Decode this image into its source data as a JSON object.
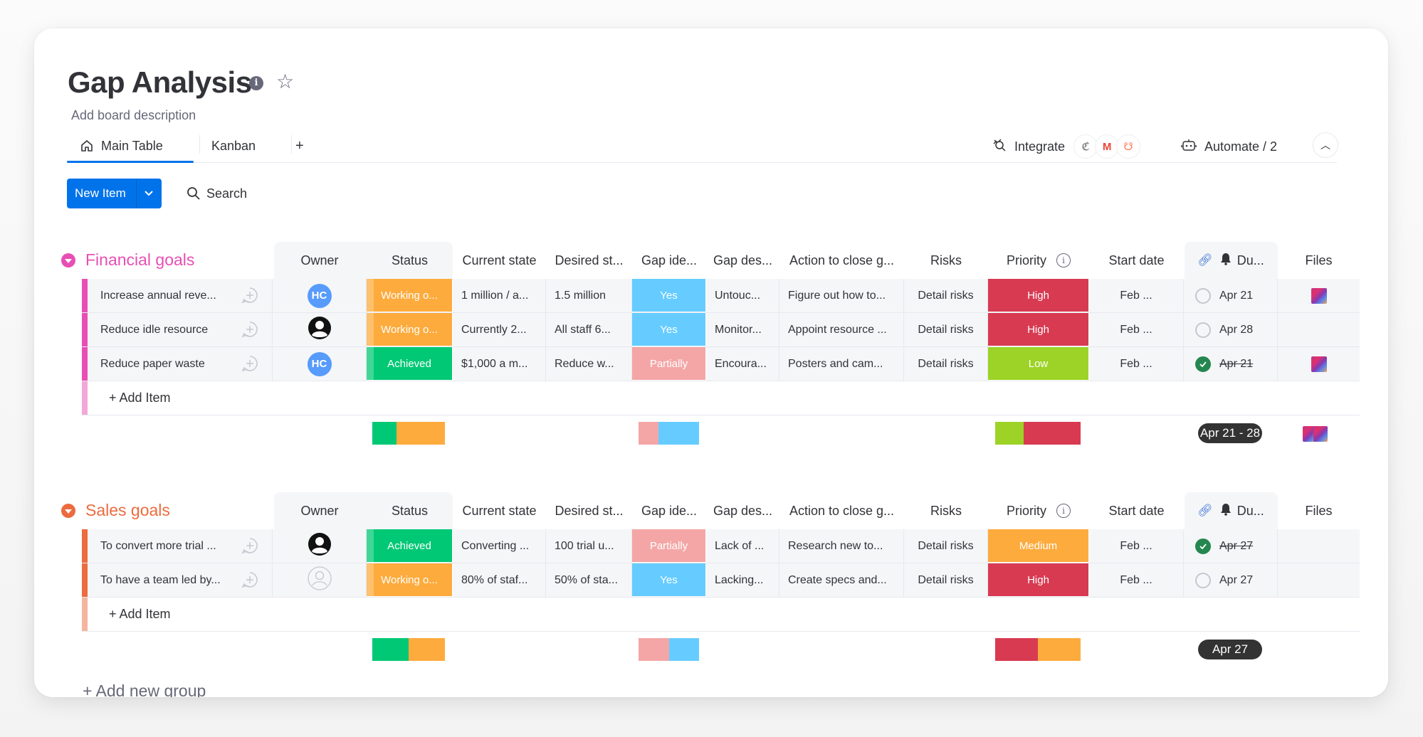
{
  "board": {
    "title": "Gap Analysis",
    "description": "Add board description",
    "info_icon": "info-icon",
    "favorite_icon": "star-icon"
  },
  "tabs": [
    {
      "label": "Main Table",
      "icon": "home-icon",
      "active": true
    },
    {
      "label": "Kanban",
      "active": false
    }
  ],
  "add_view_label": "+",
  "integrate": {
    "label": "Integrate",
    "apps": [
      "mailchimp-icon",
      "gmail-icon",
      "hubspot-icon"
    ]
  },
  "automate": {
    "label": "Automate / 2"
  },
  "toolbar": {
    "new_item_label": "New Item",
    "search_label": "Search"
  },
  "columns": [
    "Owner",
    "Status",
    "Current state",
    "Desired st...",
    "Gap ide...",
    "Gap des...",
    "Action to close g...",
    "Risks",
    "Priority",
    "Start date",
    "Du...",
    "Files"
  ],
  "colors": {
    "working": "#fdab3d",
    "achieved": "#00c875",
    "yes": "#66ccff",
    "partially": "#f4a6a6",
    "high": "#d83a52",
    "low": "#9cd326",
    "medium": "#fdab3d",
    "financial_group": "#e44fb6",
    "sales_group": "#ec6b3f",
    "primary": "#0073ea"
  },
  "groups": [
    {
      "name": "Financial goals",
      "color": "#e84fb3",
      "add_item_label": "+ Add Item",
      "items": [
        {
          "name": "Increase annual reve...",
          "owner": "HC",
          "owner_type": "initials",
          "status": "Working o...",
          "status_key": "working",
          "current_state": "1 million / a...",
          "desired_state": "1.5 million",
          "gap_identified": "Yes",
          "gap_key": "yes",
          "gap_description": "Untouc...",
          "action": "Figure out how to...",
          "risks": "Detail risks",
          "priority": "High",
          "priority_key": "high",
          "start_date": "Feb ...",
          "due": "Apr 21",
          "due_done": false,
          "files": 1
        },
        {
          "name": "Reduce idle resource",
          "owner": "",
          "owner_type": "photo",
          "status": "Working o...",
          "status_key": "working",
          "current_state": "Currently 2...",
          "desired_state": "All staff 6...",
          "gap_identified": "Yes",
          "gap_key": "yes",
          "gap_description": "Monitor...",
          "action": "Appoint resource ...",
          "risks": "Detail risks",
          "priority": "High",
          "priority_key": "high",
          "start_date": "Feb ...",
          "due": "Apr 28",
          "due_done": false,
          "files": 0
        },
        {
          "name": "Reduce paper waste",
          "owner": "HC",
          "owner_type": "initials",
          "status": "Achieved",
          "status_key": "achieved",
          "current_state": "$1,000 a m...",
          "desired_state": "Reduce w...",
          "gap_identified": "Partially",
          "gap_key": "partially",
          "gap_description": "Encoura...",
          "action": "Posters and cam...",
          "risks": "Detail risks",
          "priority": "Low",
          "priority_key": "low",
          "start_date": "Feb ...",
          "due": "Apr 21",
          "due_done": true,
          "files": 1
        }
      ],
      "summary": {
        "status": [
          {
            "key": "achieved",
            "fraction": 0.33
          },
          {
            "key": "working",
            "fraction": 0.67
          }
        ],
        "gap": [
          {
            "key": "partially",
            "fraction": 0.33
          },
          {
            "key": "yes",
            "fraction": 0.67
          }
        ],
        "priority": [
          {
            "key": "low",
            "fraction": 0.33
          },
          {
            "key": "high",
            "fraction": 0.67
          }
        ],
        "due_range": "Apr 21 - 28",
        "files": 2
      }
    },
    {
      "name": "Sales goals",
      "color": "#ec6b3f",
      "add_item_label": "+ Add Item",
      "items": [
        {
          "name": "To convert more trial ...",
          "owner": "",
          "owner_type": "photo",
          "status": "Achieved",
          "status_key": "achieved",
          "current_state": "Converting ...",
          "desired_state": "100 trial u...",
          "gap_identified": "Partially",
          "gap_key": "partially",
          "gap_description": "Lack of ...",
          "action": "Research new to...",
          "risks": "Detail risks",
          "priority": "Medium",
          "priority_key": "medium",
          "start_date": "Feb ...",
          "due": "Apr 27",
          "due_done": true,
          "files": 0
        },
        {
          "name": "To have a team led by...",
          "owner": "",
          "owner_type": "empty",
          "status": "Working o...",
          "status_key": "working",
          "current_state": "80% of staf...",
          "desired_state": "50% of sta...",
          "gap_identified": "Yes",
          "gap_key": "yes",
          "gap_description": "Lacking...",
          "action": "Create specs and...",
          "risks": "Detail risks",
          "priority": "High",
          "priority_key": "high",
          "start_date": "Feb ...",
          "due": "Apr 27",
          "due_done": false,
          "files": 0
        }
      ],
      "summary": {
        "status": [
          {
            "key": "achieved",
            "fraction": 0.5
          },
          {
            "key": "working",
            "fraction": 0.5
          }
        ],
        "gap": [
          {
            "key": "partially",
            "fraction": 0.5
          },
          {
            "key": "yes",
            "fraction": 0.5
          }
        ],
        "priority": [
          {
            "key": "high",
            "fraction": 0.5
          },
          {
            "key": "medium",
            "fraction": 0.5
          }
        ],
        "due_range": "Apr 27",
        "files": 0
      }
    }
  ],
  "add_group_label": "+ Add new group"
}
